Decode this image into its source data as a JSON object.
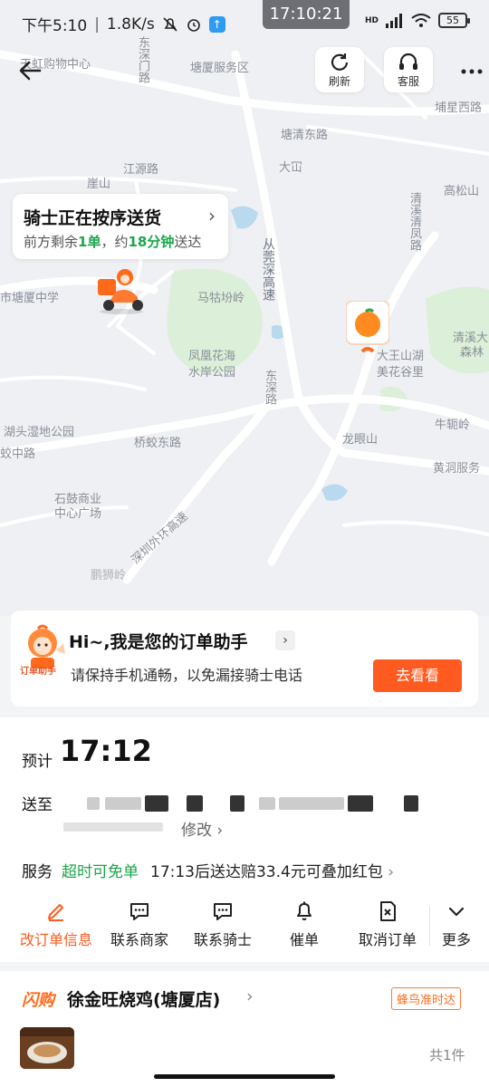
{
  "status_bar": {
    "time": "下午5:10",
    "speed": "1.8K/s",
    "center_clock": "17:10:21",
    "network": "HD",
    "battery": "55"
  },
  "top_actions": {
    "refresh_label": "刷新",
    "service_label": "客服"
  },
  "map_labels": [
    "天虹购物中心",
    "塘厦服务区",
    "东深门路",
    "塘清东路",
    "大冚",
    "埔星西路",
    "江源路",
    "崖山",
    "高松山",
    "清溪清凤路",
    "从莞深高速",
    "市塘厦中学",
    "马牯坋岭",
    "凤凰花海",
    "水岸公园",
    "大王山湖",
    "美花谷里",
    "清溪大",
    "森林",
    "东深路",
    "湖头湿地公园",
    "蛟中路",
    "桥蛟东路",
    "龙眼山",
    "牛轭岭",
    "黄洞服务",
    "石鼓商业",
    "中心广场",
    "深圳外环高速",
    "鹏狮岭"
  ],
  "rider": {
    "title": "骑士正在按序送货",
    "remain_prefix": "前方剩余",
    "remain_count": "1单",
    "eta_prefix": "，约",
    "eta_minutes": "18分钟",
    "eta_suffix": "送达"
  },
  "assistant": {
    "mascot_tag": "订单助手",
    "title": "Hi~,我是您的订单助手",
    "description": "请保持手机通畅，以免漏接骑士电话",
    "button": "去看看"
  },
  "delivery": {
    "eta_label": "预计",
    "eta_time": "17:12",
    "address_label": "送至",
    "edit_label": "修改",
    "service_label": "服务",
    "service_tag": "超时可免单",
    "service_text": "17:13后送达赔33.4元可叠加红包"
  },
  "actions": [
    {
      "label": "改订单信息",
      "icon": "edit-icon"
    },
    {
      "label": "联系商家",
      "icon": "chat-icon"
    },
    {
      "label": "联系骑士",
      "icon": "chat-icon"
    },
    {
      "label": "催单",
      "icon": "bell-icon"
    },
    {
      "label": "取消订单",
      "icon": "cancel-order-icon"
    },
    {
      "label": "更多",
      "icon": "chevron-down-icon"
    }
  ],
  "shop": {
    "flash_label": "闪购",
    "name": "徐金旺烧鸡(塘厦店)",
    "badge": "蜂鸟准时达",
    "item_count": "共1件"
  },
  "colors": {
    "accent": "#ff5a1f",
    "green": "#1aa64a",
    "map_bg": "#eef0f3"
  }
}
